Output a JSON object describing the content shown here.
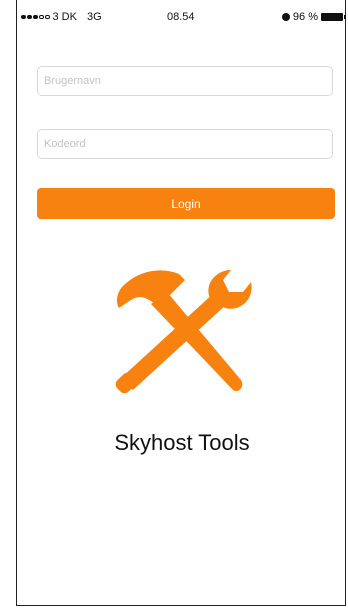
{
  "status_bar": {
    "carrier": "3 DK",
    "network": "3G",
    "time": "08.54",
    "battery": "96 %"
  },
  "login": {
    "username_placeholder": "Brugernavn",
    "password_placeholder": "Kodeord",
    "login_label": "Login"
  },
  "app": {
    "title": "Skyhost Tools",
    "accent_color": "#f7820f"
  }
}
